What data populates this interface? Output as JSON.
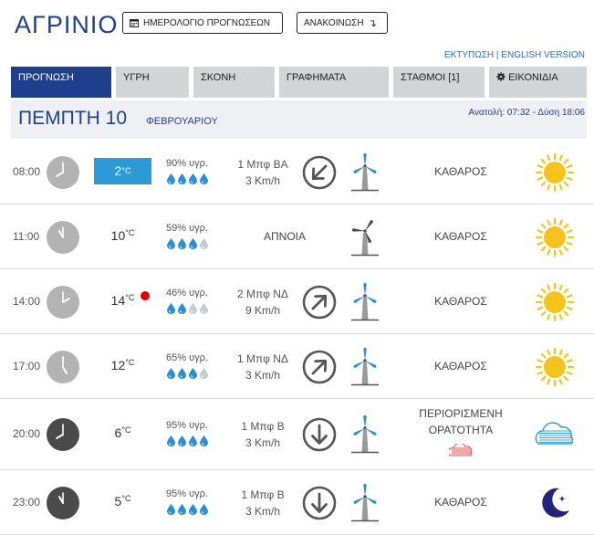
{
  "header": {
    "city": "ΑΓΡΙΝΙΟ",
    "calendar_button": "ΗΜΕΡΟΛΟΓΙΟ ΠΡΟΓΝΩΣΕΩΝ",
    "announcement_button": "ΑΝΑΚΟΙΝΩΣΗ",
    "print_link": "ΕΚΤΥΠΩΣΗ",
    "separator": "|",
    "english_link": "ENGLISH VERSION"
  },
  "tabs": [
    {
      "label": "ΠΡΟΓΝΩΣΗ",
      "active": true
    },
    {
      "label": "ΥΓΡΗ",
      "active": false
    },
    {
      "label": "ΣΚΟΝΗ",
      "active": false
    },
    {
      "label": "ΓΡΑΦΗΜΑΤΑ",
      "active": false
    },
    {
      "label": "ΣΤΑΘΜΟΙ [1]",
      "active": false
    },
    {
      "label": "ΕΙΚΟΝΙΔΙΑ",
      "icon": "gear-icon",
      "active": false
    }
  ],
  "day": {
    "name": "ΠΕΜΠΤΗ 10",
    "month": "ΦΕΒΡΟΥΑΡΙΟΥ",
    "sunrise_label": "Ανατολή:",
    "sunrise": "07:32",
    "sunset_label": "- Δύση",
    "sunset": "18:06"
  },
  "units": {
    "celsius": "°C",
    "humidity_suffix": "υγρ."
  },
  "colors": {
    "brand_blue": "#1d3f8c",
    "cold_temp": "#2c9ad6",
    "drop_blue": "#2a8fd6",
    "drop_grey": "#c4cbd1",
    "sun": "#f6c31d",
    "alert_red": "#e10000"
  },
  "forecast": [
    {
      "time": "08:00",
      "temp": "2",
      "cold": true,
      "alert": false,
      "humidity": "90%",
      "drops_filled": 4,
      "wind_force": "1 Μπφ ΒΑ",
      "wind_speed": "3 Km/h",
      "wind_calm": "",
      "wind_arrow": "arrow-down-left-icon",
      "visibility": "ΚΑΘΑΡΟΣ",
      "weather_icon": "sun-icon"
    },
    {
      "time": "11:00",
      "temp": "10",
      "cold": false,
      "alert": false,
      "humidity": "59%",
      "drops_filled": 3,
      "wind_force": "",
      "wind_speed": "",
      "wind_calm": "ΑΠΝΟΙΑ",
      "wind_arrow": "",
      "visibility": "ΚΑΘΑΡΟΣ",
      "weather_icon": "sun-icon"
    },
    {
      "time": "14:00",
      "temp": "14",
      "cold": false,
      "alert": true,
      "humidity": "46%",
      "drops_filled": 2,
      "wind_force": "2 Μπφ ΝΔ",
      "wind_speed": "9 Km/h",
      "wind_calm": "",
      "wind_arrow": "arrow-up-right-icon",
      "visibility": "ΚΑΘΑΡΟΣ",
      "weather_icon": "sun-icon"
    },
    {
      "time": "17:00",
      "temp": "12",
      "cold": false,
      "alert": false,
      "humidity": "65%",
      "drops_filled": 3,
      "wind_force": "1 Μπφ ΝΔ",
      "wind_speed": "3 Km/h",
      "wind_calm": "",
      "wind_arrow": "arrow-up-right-icon",
      "visibility": "ΚΑΘΑΡΟΣ",
      "weather_icon": "sun-icon"
    },
    {
      "time": "20:00",
      "temp": "6",
      "cold": false,
      "alert": false,
      "humidity": "95%",
      "drops_filled": 4,
      "wind_force": "1 Μπφ Β",
      "wind_speed": "3 Km/h",
      "wind_calm": "",
      "wind_arrow": "arrow-down-icon",
      "visibility": "ΠΕΡΙΟΡΙΣΜΕΝΗ ΟΡΑΤΟΤΗΤΑ",
      "weather_icon": "fog-icon"
    },
    {
      "time": "23:00",
      "temp": "5",
      "cold": false,
      "alert": false,
      "humidity": "95%",
      "drops_filled": 4,
      "wind_force": "1 Μπφ Β",
      "wind_speed": "3 Km/h",
      "wind_calm": "",
      "wind_arrow": "arrow-down-icon",
      "visibility": "ΚΑΘΑΡΟΣ",
      "weather_icon": "moon-icon"
    }
  ]
}
